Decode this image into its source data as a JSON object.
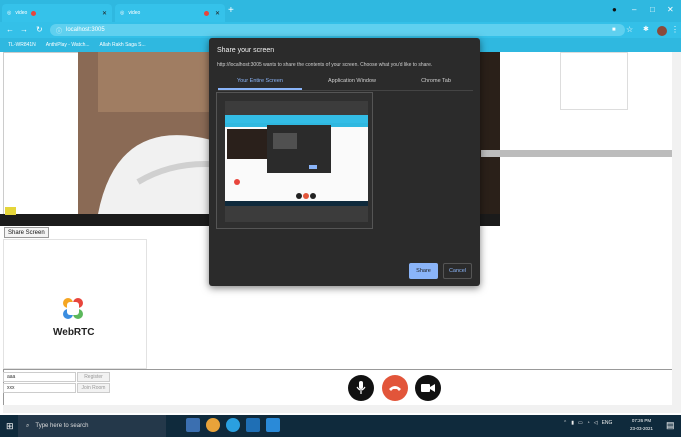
{
  "browser": {
    "tabs": [
      {
        "title": "video"
      },
      {
        "title": "video"
      }
    ],
    "address": "localhost:3005",
    "bookmarks": [
      "TL-WR841N",
      "AnthiPlay - Watch...",
      "Allah Rakh Saga S..."
    ]
  },
  "page": {
    "share_screen_label": "Share Screen",
    "logo_text": "WebRTC",
    "name_input_value": "aaa",
    "room_input_value": "xxx",
    "register_label": "Register",
    "join_room_label": "Join Room"
  },
  "dialog": {
    "title": "Share your screen",
    "subtitle": "http://localhost:3005 wants to share the contents of your screen. Choose what you'd like to share.",
    "tabs": [
      "Your Entire Screen",
      "Application Window",
      "Chrome Tab"
    ],
    "selected_tab": "Your Entire Screen",
    "share_label": "Share",
    "cancel_label": "Cancel"
  },
  "call_controls": {
    "mic_color": "#111111",
    "hangup_color": "#e2553a",
    "camera_color": "#111111"
  },
  "taskbar": {
    "search_placeholder": "Type here to search",
    "language": "ENG",
    "time": "07:26 PM",
    "date": "23-03-2021"
  }
}
